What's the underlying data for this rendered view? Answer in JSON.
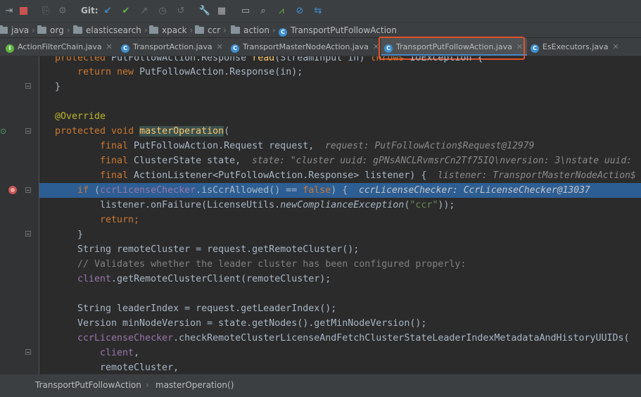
{
  "toolbar": {
    "git_label": "Git:",
    "icons": [
      "step-icon",
      "stop-icon",
      "mute-breakpoints-icon",
      "settings-icon",
      "git-update-icon",
      "git-commit-icon",
      "git-push-icon",
      "history-icon",
      "rollback-icon",
      "wrench-icon",
      "project-structure-icon",
      "terminal-icon",
      "search-icon",
      "activity-icon",
      "no-icon",
      "sync-icon"
    ]
  },
  "breadcrumb": {
    "items": [
      "java",
      "org",
      "elasticsearch",
      "xpack",
      "ccr",
      "action",
      "TransportPutFollowAction"
    ]
  },
  "tabs": [
    {
      "label": "ActionFilterChain.java",
      "type": "interface"
    },
    {
      "label": "TransportAction.java",
      "type": "class"
    },
    {
      "label": "TransportMasterNodeAction.java",
      "type": "class"
    },
    {
      "label": "TransportPutFollowAction.java",
      "type": "class",
      "active": true
    },
    {
      "label": "EsExecutors.java",
      "type": "class"
    }
  ],
  "code": {
    "line0": {
      "kw": "protected ",
      "t1": "PutFollowAction.Response ",
      "fn": "read",
      "t2": "(StreamInput in) ",
      "kw2": "throws ",
      "t3": "IOException {"
    },
    "line1": {
      "kw1": "return ",
      "kw2": "new ",
      "t": "PutFollowAction.Response(in);"
    },
    "line2": "}",
    "line4": "@Override",
    "line5": {
      "kw": "protected void ",
      "fn": "masterOperation",
      "t": "("
    },
    "line6": {
      "kw": "final ",
      "t": "PutFollowAction.Request request,",
      "hint": "request: PutFollowAction$Request@12979"
    },
    "line7": {
      "kw": "final ",
      "t": "ClusterState state,",
      "hint": "state: \"cluster uuid: gPNsANCLRvmsrCn2Tf75IQ\\nversion: 3\\nstate uuid:"
    },
    "line8": {
      "kw": "final ",
      "t": "ActionListener<PutFollowAction.Response> listener) {",
      "hint": "listener: TransportMasterNodeAction$"
    },
    "line9": {
      "kw": "if ",
      "p1": "(",
      "fld": "ccrLicenseChecker",
      "t": ".isCcrAllowed() == ",
      "kw2": "false",
      "t2": ") {",
      "hint": "ccrLicenseChecker: CcrLicenseChecker@13037"
    },
    "line10": {
      "t1": "listener.onFailure(LicenseUtils.",
      "it": "newComplianceException",
      "t2": "(",
      "str": "\"ccr\"",
      "t3": "));"
    },
    "line11": "return;",
    "line12": "}",
    "line13": "String remoteCluster = request.getRemoteCluster();",
    "line14": "// Validates whether the leader cluster has been configured properly:",
    "line15": {
      "fld": "client",
      "t": ".getRemoteClusterClient(remoteCluster);"
    },
    "line17": "String leaderIndex = request.getLeaderIndex();",
    "line18": "Version minNodeVersion = state.getNodes().getMinNodeVersion();",
    "line19": {
      "fld": "ccrLicenseChecker",
      "t": ".checkRemoteClusterLicenseAndFetchClusterStateLeaderIndexMetadataAndHistoryUUIDs("
    },
    "line20": {
      "fld": "client",
      "t": ","
    },
    "line21": "remoteCluster,"
  },
  "navbar": {
    "class_name": "TransportPutFollowAction",
    "separator": "›",
    "method": "masterOperation()"
  },
  "colors": {
    "highlight_box": "#e1502b",
    "selected_line": "#2d5e93",
    "keyword": "#cc7832",
    "field": "#9876aa",
    "method": "#ffc66d",
    "annotation": "#bbb529",
    "string": "#6a8759",
    "comment": "#808080"
  }
}
